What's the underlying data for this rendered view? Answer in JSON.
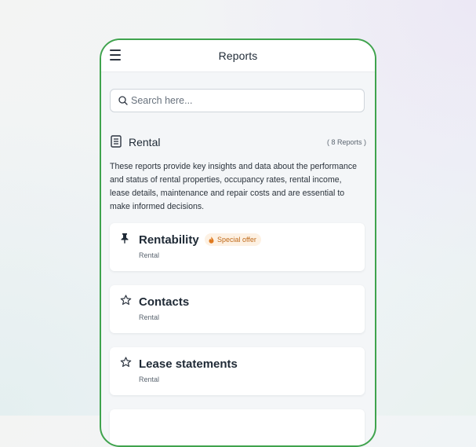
{
  "header": {
    "title": "Reports",
    "menu_icon": "hamburger-icon"
  },
  "search": {
    "placeholder": "Search here...",
    "value": ""
  },
  "section": {
    "icon": "document-icon",
    "title": "Rental",
    "count": "( 8 Reports )",
    "description": "These reports provide key insights and data about the performance and status of rental properties, occupancy rates, rental income, lease details, maintenance and repair costs and are essential to make informed decisions."
  },
  "reports": [
    {
      "title": "Rentability",
      "category": "Rental",
      "icon": "pin-icon",
      "badge": "Special offer",
      "badge_icon": "flame-icon"
    },
    {
      "title": "Contacts",
      "category": "Rental",
      "icon": "star-icon"
    },
    {
      "title": "Lease statements",
      "category": "Rental",
      "icon": "star-icon"
    }
  ],
  "colors": {
    "phone_border": "#3fa34d",
    "badge_bg": "#fdf1e3",
    "badge_text": "#c06a1a",
    "text_dark": "#1f2a36"
  }
}
